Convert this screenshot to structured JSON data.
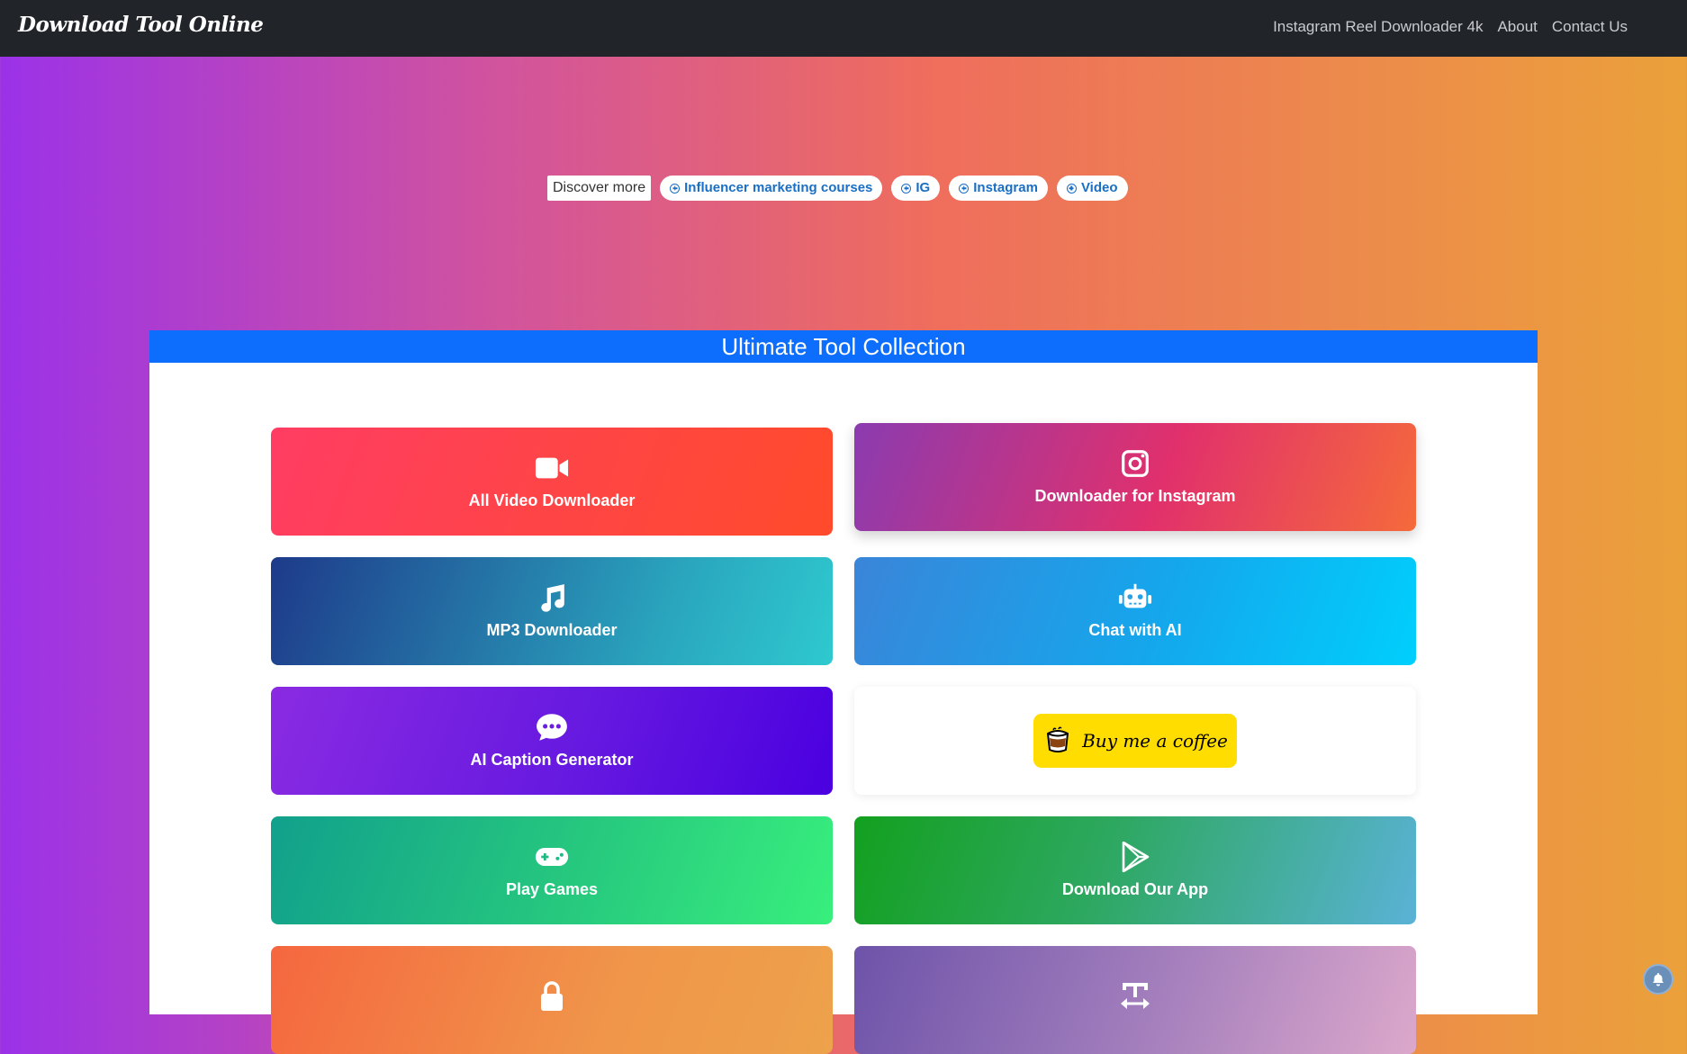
{
  "nav": {
    "brand": "Download Tool Online",
    "links": [
      "Instagram Reel Downloader 4k",
      "About",
      "Contact Us"
    ]
  },
  "discover": {
    "label": "Discover more",
    "chips": [
      "Influencer marketing courses",
      "IG",
      "Instagram",
      "Video"
    ]
  },
  "panel": {
    "title": "Ultimate Tool Collection"
  },
  "cards": {
    "all_video": {
      "label": "All Video Downloader",
      "icon": "video-camera-icon"
    },
    "instagram": {
      "label": "Downloader for Instagram",
      "icon": "instagram-icon"
    },
    "mp3": {
      "label": "MP3 Downloader",
      "icon": "music-note-icon"
    },
    "chat_ai": {
      "label": "Chat with AI",
      "icon": "robot-icon"
    },
    "caption": {
      "label": "AI Caption Generator",
      "icon": "chat-bubble-icon"
    },
    "coffee": {
      "label": "Buy me a coffee",
      "icon": "coffee-cup-icon"
    },
    "games": {
      "label": "Play Games",
      "icon": "gamepad-icon"
    },
    "app": {
      "label": "Download Our App",
      "icon": "play-store-icon"
    },
    "lock": {
      "label": "",
      "icon": "lock-icon"
    },
    "text": {
      "label": "",
      "icon": "text-width-icon"
    }
  },
  "colors": {
    "navbar": "#212529",
    "panel_header": "#0d6efd",
    "chip_text": "#1a6fc4",
    "coffee_button": "#ffdd00"
  }
}
